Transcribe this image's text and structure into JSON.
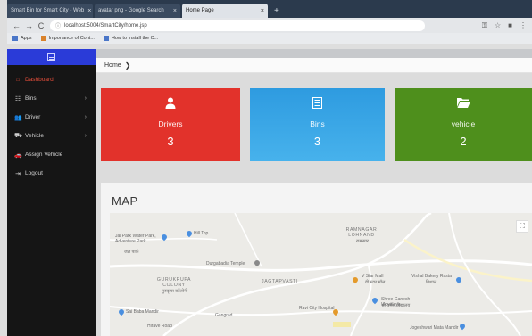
{
  "browser": {
    "tabs": [
      {
        "title": "Smart Bin for Smart City - Web",
        "active": false
      },
      {
        "title": "avatar png - Google Search",
        "active": false
      },
      {
        "title": "Home Page",
        "active": true
      }
    ],
    "new_tab": "+",
    "url": "localhost:5004/SmartCity/home.jsp",
    "bookmarks": [
      {
        "label": "Apps"
      },
      {
        "label": "Importance of Cont..."
      },
      {
        "label": "How to Install the C..."
      }
    ]
  },
  "sidebar": {
    "items": [
      {
        "label": "Dashboard",
        "icon": "home-icon",
        "glyph": "⌂",
        "has_arrow": false,
        "active": true
      },
      {
        "label": "Bins",
        "icon": "grid-icon",
        "glyph": "☷",
        "has_arrow": true,
        "active": false
      },
      {
        "label": "Driver",
        "icon": "users-icon",
        "glyph": "👥",
        "has_arrow": true,
        "active": false
      },
      {
        "label": "Vehicle",
        "icon": "truck-icon",
        "glyph": "⛟",
        "has_arrow": true,
        "active": false
      },
      {
        "label": "Assign Vehicle",
        "icon": "car-icon",
        "glyph": "🚗",
        "has_arrow": false,
        "active": false
      },
      {
        "label": "Logout",
        "icon": "logout-icon",
        "glyph": "⇥",
        "has_arrow": false,
        "active": false
      }
    ]
  },
  "breadcrumb": {
    "home": "Home",
    "separator": "❯"
  },
  "cards": [
    {
      "label": "Drivers",
      "value": "3",
      "icon": "user-icon",
      "color": "#e2322b"
    },
    {
      "label": "Bins",
      "value": "3",
      "icon": "list-icon",
      "color": "#3aa7e6"
    },
    {
      "label": "vehicle",
      "value": "2",
      "icon": "folder-icon",
      "color": "#4e8f1c"
    }
  ],
  "map": {
    "title": "MAP",
    "labels": {
      "park": "Jal Park Water Park, Adventure Park",
      "park_local": "जल पार्क",
      "hill": "Hill Top",
      "temple": "Durgabadia Temple",
      "colony": "GURUKRUPA COLONY",
      "colony_local": "गुरुकृपा कॉलोनी",
      "vasti": "JAGTAPVASTI",
      "nagar": "RAMNAGAR LOHNAND",
      "nagar_local": "रामनगर",
      "mall": "V Star Mall",
      "mall_local": "वी स्टार मॉल",
      "hotel": "Vishal Bakery Rasta",
      "hotel_local": "विशाल",
      "school": "Shree Ganesh Vidyalaya",
      "school_local": "श्री गणेश विद्यालय",
      "masjid": "Sai Baba Mandir",
      "gang": "Gangrad",
      "hospital": "Ravi City Hospital",
      "road": "Hirave Road",
      "bottom": "Jogeshwari Mata Mandir"
    },
    "fullscreen": "⛶"
  }
}
